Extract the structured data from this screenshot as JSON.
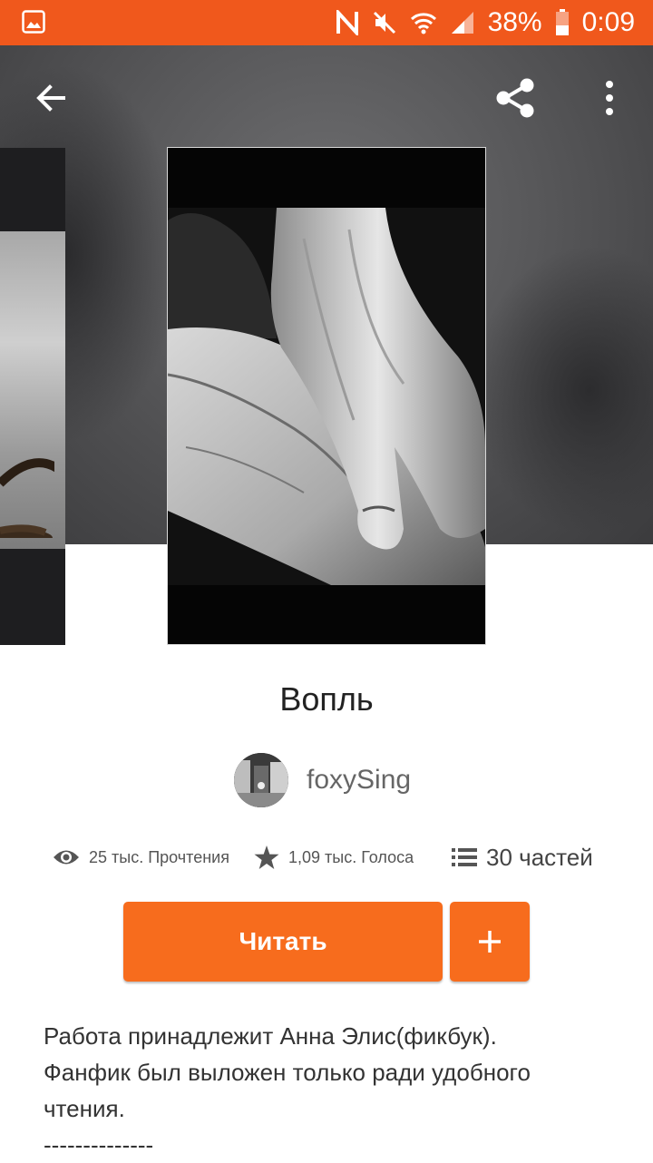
{
  "status_bar": {
    "battery": "38%",
    "time": "0:09"
  },
  "story": {
    "title": "Вопль",
    "author": "foxySing",
    "reads": "25 тыс. Прочтения",
    "votes": "1,09 тыс. Голоса",
    "parts": "30 частей"
  },
  "actions": {
    "read_label": "Читать",
    "add_label": "+"
  },
  "description": {
    "line1": "Работа принадлежит Анна Элис(фикбук).",
    "line2": "Фанфик был выложен только ради удобного",
    "line3": "чтения.",
    "line4": "--------------"
  },
  "colors": {
    "accent": "#f76c1d",
    "status_bar": "#f0581c"
  }
}
